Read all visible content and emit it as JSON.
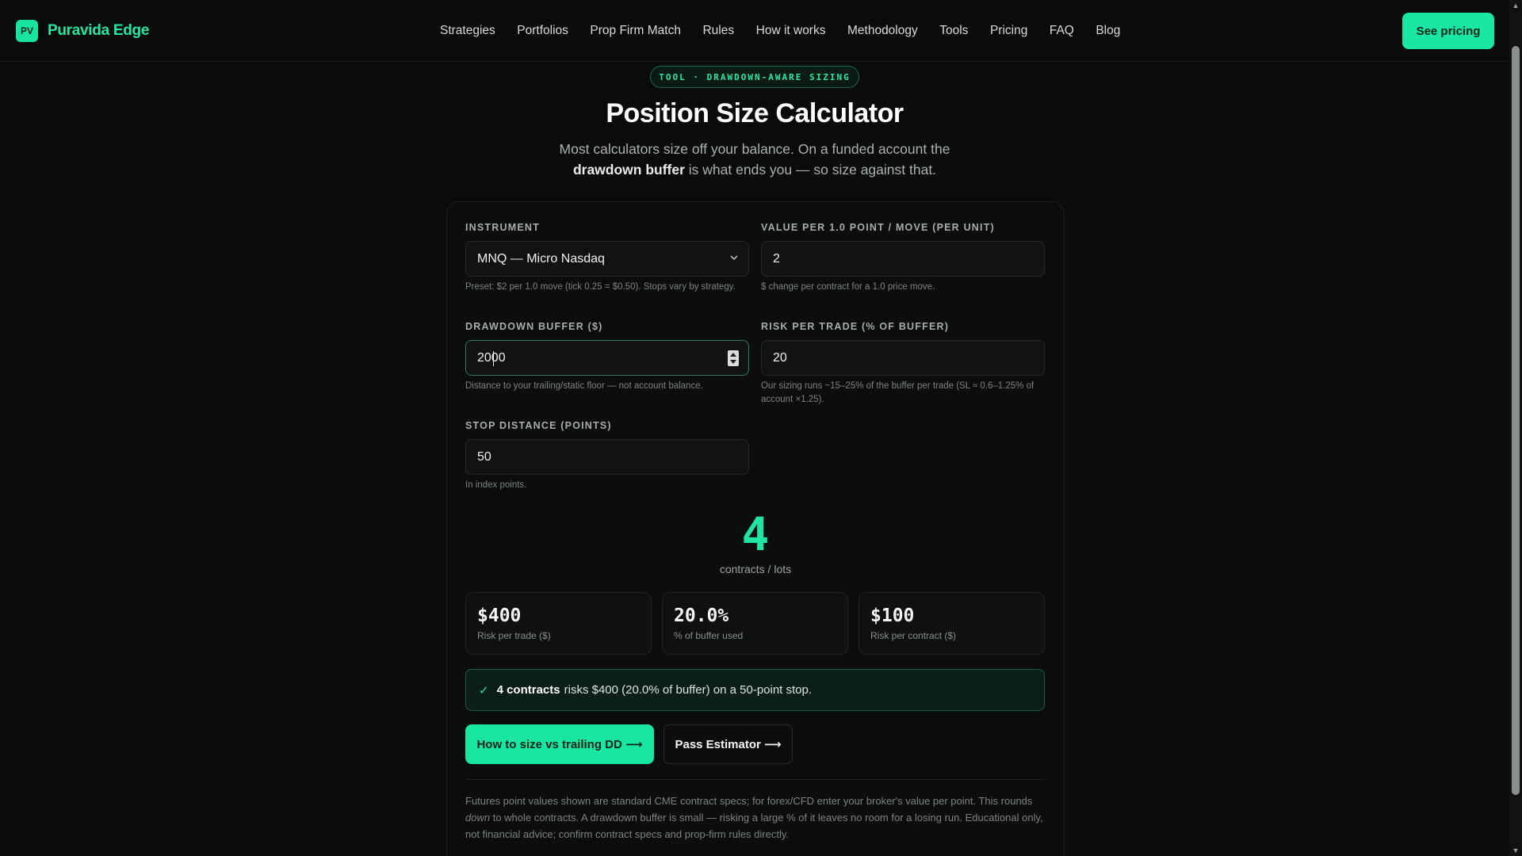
{
  "brand": {
    "badge": "PV",
    "name": "Puravida Edge"
  },
  "nav": {
    "items": [
      "Strategies",
      "Portfolios",
      "Prop Firm Match",
      "Rules",
      "How it works",
      "Methodology",
      "Tools",
      "Pricing",
      "FAQ",
      "Blog"
    ],
    "cta": "See pricing"
  },
  "hero": {
    "pill": "TOOL · DRAWDOWN-AWARE SIZING",
    "title": "Position Size Calculator",
    "subtitle_a": "Most calculators size off your balance. On a funded account the",
    "subtitle_bold": "drawdown buffer",
    "subtitle_b": "is what ends you — so size against that."
  },
  "form": {
    "instrument": {
      "label": "INSTRUMENT",
      "value": "MNQ — Micro Nasdaq",
      "hint": "Preset: $2 per 1.0 move (tick 0.25 = $0.50). Stops vary by strategy."
    },
    "value_per_point": {
      "label": "VALUE PER 1.0 POINT / MOVE (PER UNIT)",
      "value": "2",
      "hint": "$ change per contract for a 1.0 price move."
    },
    "drawdown_buffer": {
      "label": "DRAWDOWN BUFFER ($)",
      "value": "2000",
      "hint": "Distance to your trailing/static floor — not account balance."
    },
    "risk_per_trade": {
      "label": "RISK PER TRADE (% OF BUFFER)",
      "value": "20",
      "hint": "Our sizing runs ~15–25% of the buffer per trade (SL ≈ 0.6–1.25% of account ×1.25)."
    },
    "stop_distance": {
      "label": "STOP DISTANCE (POINTS)",
      "value": "50",
      "hint": "In index points."
    }
  },
  "result": {
    "contracts": "4",
    "contracts_label": "contracts / lots",
    "stats": [
      {
        "value": "$400",
        "label": "Risk per trade ($)"
      },
      {
        "value": "20.0%",
        "label": "% of buffer used"
      },
      {
        "value": "$100",
        "label": "Risk per contract ($)"
      }
    ],
    "check": "✓",
    "summary_bold": "4 contracts",
    "summary_rest": "risks $400 (20.0% of buffer) on a 50-point stop."
  },
  "buttons": {
    "primary": "How to size vs trailing DD ⟶",
    "secondary": "Pass Estimator ⟶"
  },
  "footnote": {
    "a": "Futures point values shown are standard CME contract specs; for forex/CFD enter your broker's value per point. This rounds",
    "em": "down",
    "b": "to whole contracts. A drawdown buffer is small — risking a large % of it leaves no room for a losing run. Educational only, not financial advice; confirm contract specs and prop-firm rules directly."
  },
  "colors": {
    "accent": "#18e6a2",
    "background": "#0a0b0b"
  }
}
